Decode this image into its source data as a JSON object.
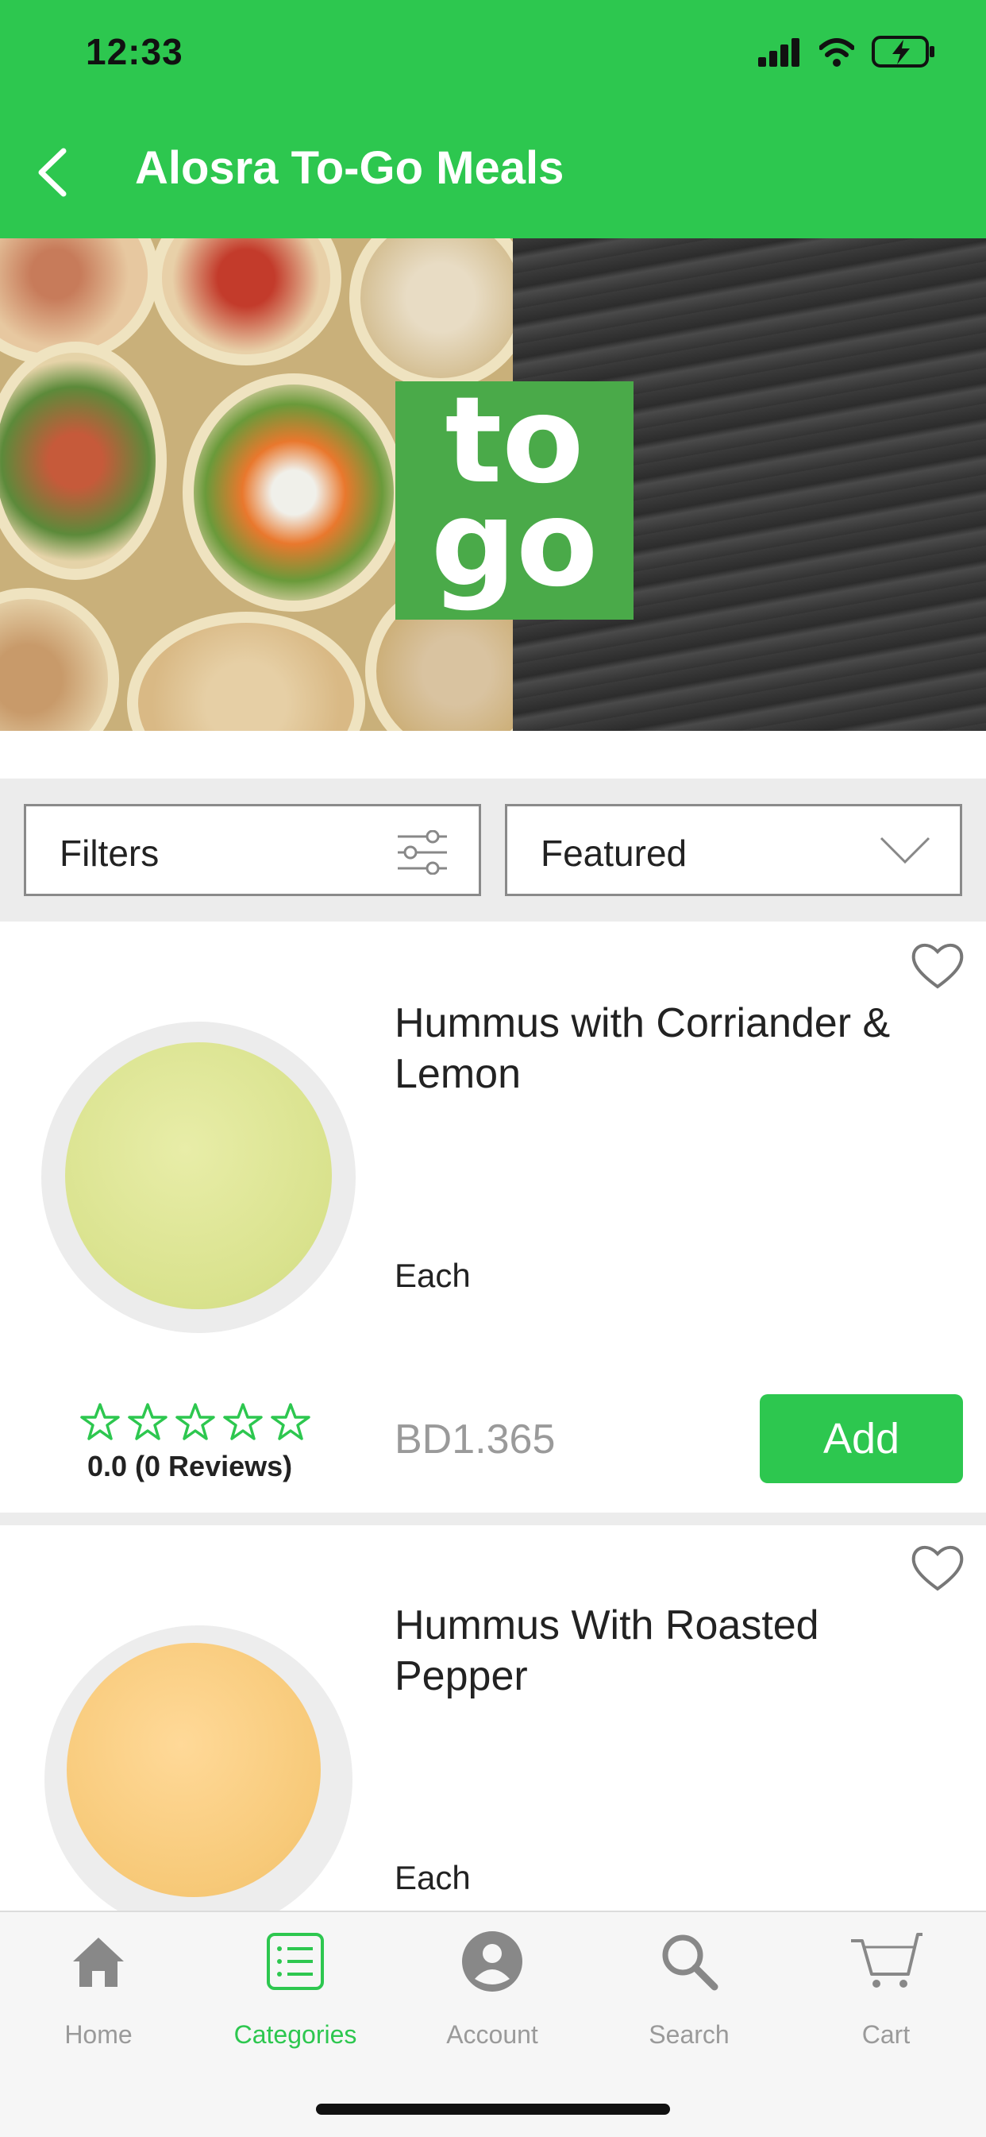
{
  "status_bar": {
    "time": "12:33"
  },
  "header": {
    "title": "Alosra To-Go Meals",
    "back_icon": "back-chevron-icon"
  },
  "banner": {
    "logo_line1": "to",
    "logo_line2": "go"
  },
  "filters": {
    "filter_label": "Filters",
    "sort_label": "Featured"
  },
  "products": [
    {
      "name": "Hummus with Corriander & Lemon",
      "unit": "Each",
      "price": "BD1.365",
      "add_label": "Add",
      "rating_text": "0.0 (0 Reviews)",
      "stars": 0
    },
    {
      "name": "Hummus With Roasted Pepper",
      "unit": "Each"
    }
  ],
  "tabs": [
    {
      "label": "Home",
      "icon": "home-icon"
    },
    {
      "label": "Categories",
      "icon": "categories-list-icon",
      "active": true
    },
    {
      "label": "Account",
      "icon": "account-icon"
    },
    {
      "label": "Search",
      "icon": "search-icon"
    },
    {
      "label": "Cart",
      "icon": "cart-icon"
    }
  ],
  "colors": {
    "brand_green": "#2dc74f",
    "price_gray": "#9a9a9a",
    "tab_inactive": "#9a9a9a"
  }
}
